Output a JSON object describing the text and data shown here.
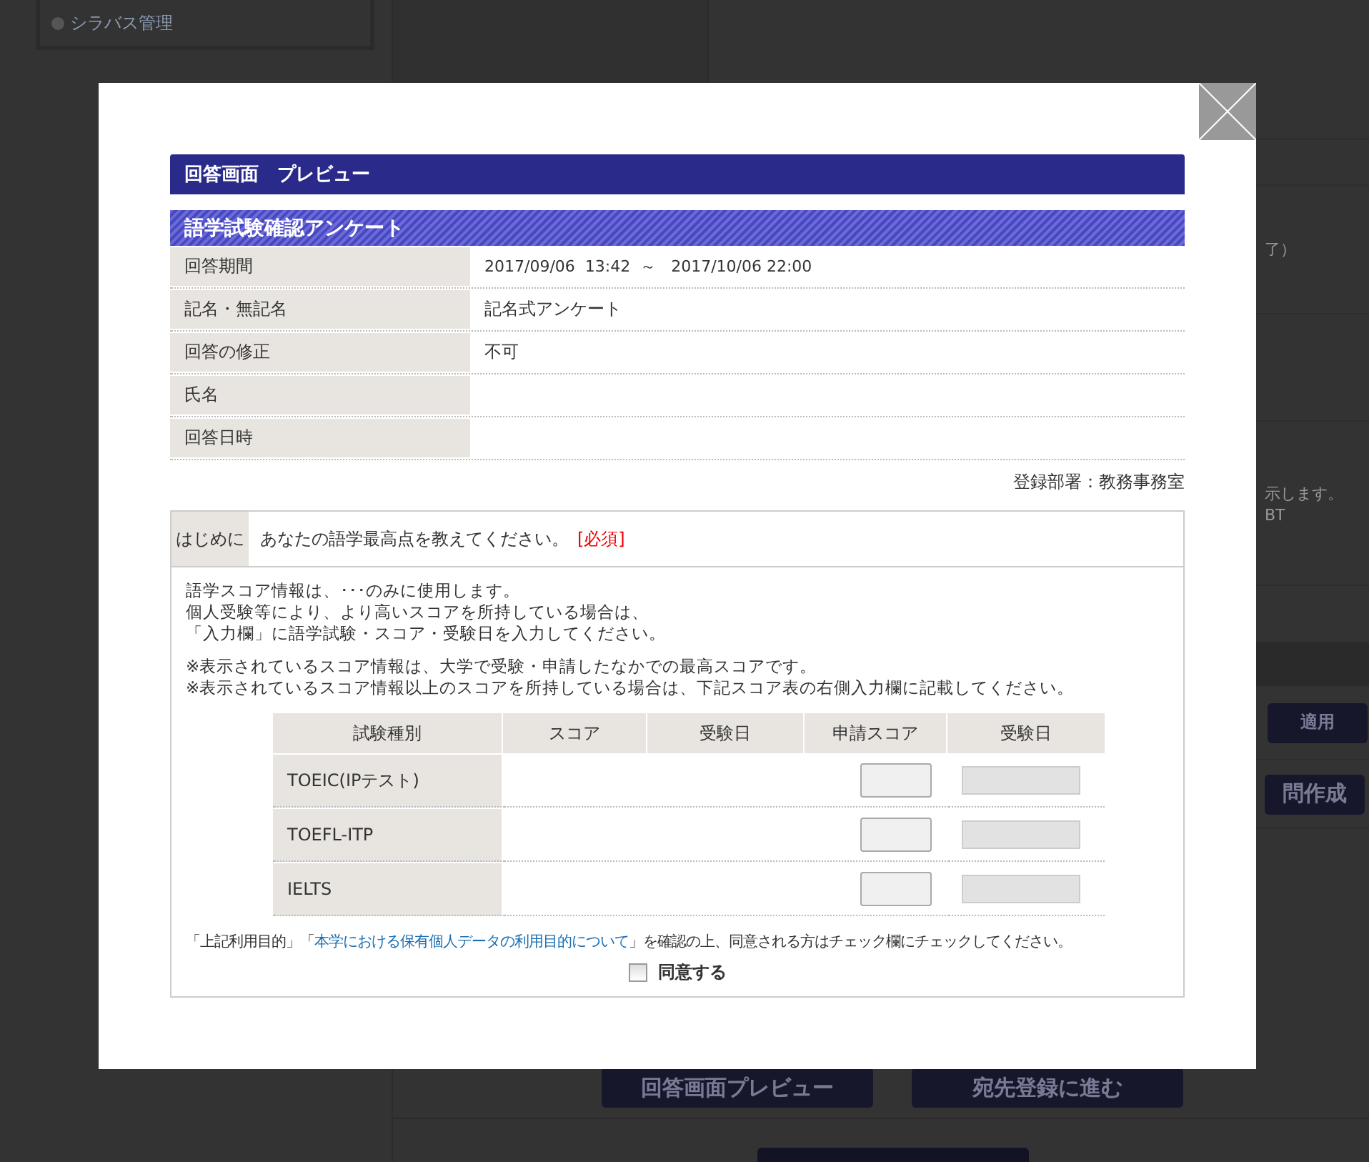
{
  "background": {
    "sidebar_item": "シラバス管理",
    "text_1": "了）",
    "text_2": "示します。",
    "text_3": "BT",
    "apply_button": "適用",
    "create_button": "問作成",
    "buttons": [
      "回答画面プレビュー",
      "宛先登録に進む"
    ]
  },
  "modal": {
    "title": "回答画面　プレビュー",
    "survey_title": "語学試験確認アンケート",
    "info": [
      {
        "label": "回答期間",
        "value": "2017/09/06  13:42  ～   2017/10/06 22:00"
      },
      {
        "label": "記名・無記名",
        "value": "記名式アンケート"
      },
      {
        "label": "回答の修正",
        "value": "不可"
      },
      {
        "label": "氏名"
      },
      {
        "label": "回答日時"
      }
    ],
    "department": "登録部署：教務事務室",
    "question": {
      "label": "はじめに",
      "text": "あなたの語学最高点を教えてください。",
      "required": "[必須]",
      "description": [
        "語学スコア情報は、･･･のみに使用します。",
        "個人受験等により、より高いスコアを所持している場合は、",
        "「入力欄」に語学試験・スコア・受験日を入力してください。"
      ],
      "notes": [
        "※表示されているスコア情報は、大学で受験・申請したなかでの最高スコアです。",
        "※表示されているスコア情報以上のスコアを所持している場合は、下記スコア表の右側入力欄に記載してください。"
      ],
      "columns": [
        "試験種別",
        "スコア",
        "受験日",
        "申請スコア",
        "受験日"
      ],
      "rows": [
        {
          "exam": "TOEIC(IPテスト)",
          "date_disabled": true
        },
        {
          "exam": "TOEFL-ITP",
          "date_disabled": true
        },
        {
          "exam": "IELTS",
          "date_disabled": true
        }
      ],
      "consent_before": "「上記利用目的」「",
      "consent_link": "本学における保有個人データの利用目的について",
      "consent_after": "」を確認の上、同意される方はチェック欄にチェックしてください。",
      "agree": {
        "label": "同意する",
        "checked": false
      }
    }
  }
}
